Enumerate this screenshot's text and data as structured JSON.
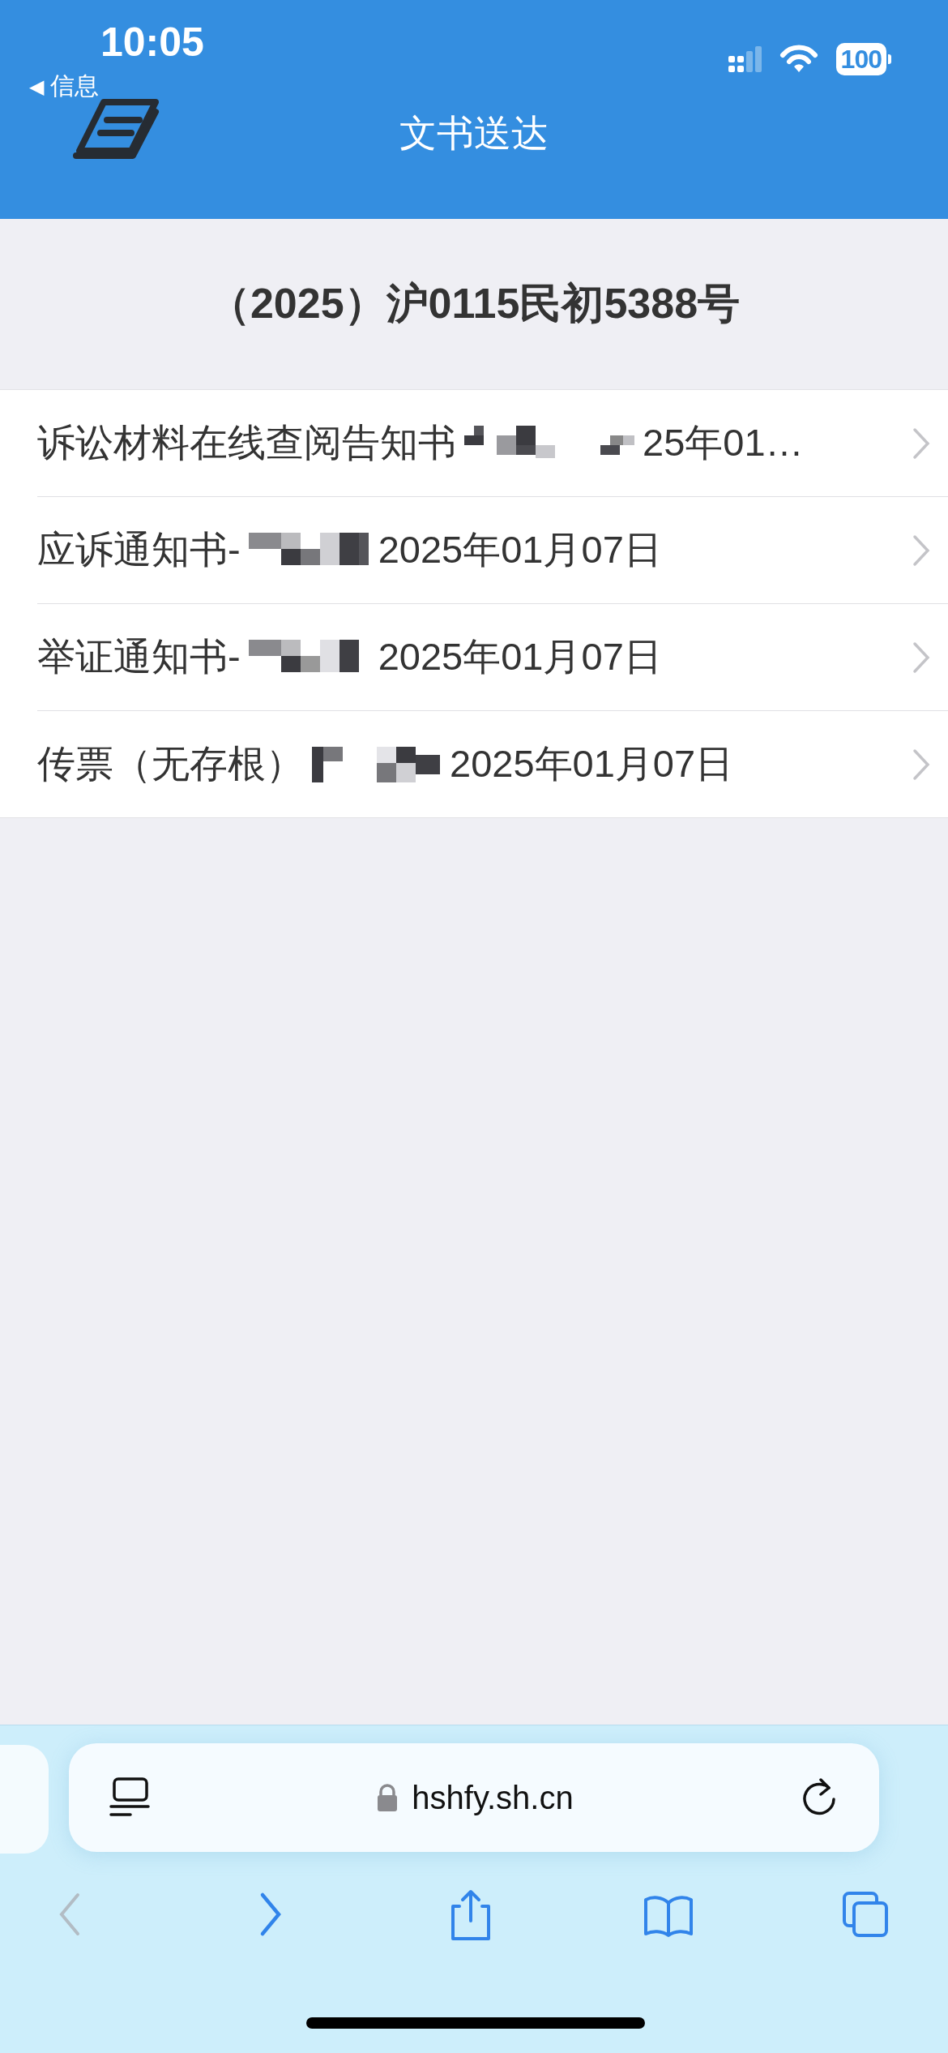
{
  "status_bar": {
    "time": "10:05",
    "back_arrow": "◀",
    "back_label": "信息",
    "battery": "100"
  },
  "header": {
    "title": "文书送达"
  },
  "case_number": "（2025）沪0115民初5388号",
  "documents": [
    {
      "title": "诉讼材料在线查阅告知书",
      "date": "25年01…"
    },
    {
      "title": "应诉通知书-",
      "date": "2025年01月07日"
    },
    {
      "title": "举证通知书-",
      "date": "2025年01月07日"
    },
    {
      "title": "传票（无存根）",
      "date": "2025年01月07日"
    }
  ],
  "browser": {
    "url": "hshfy.sh.cn",
    "nav": [
      {
        "kind": "back",
        "disabled": true
      },
      {
        "kind": "forward",
        "disabled": false
      },
      {
        "kind": "share",
        "disabled": false
      },
      {
        "kind": "bookmarks",
        "disabled": false
      },
      {
        "kind": "tabs",
        "disabled": false
      }
    ]
  }
}
